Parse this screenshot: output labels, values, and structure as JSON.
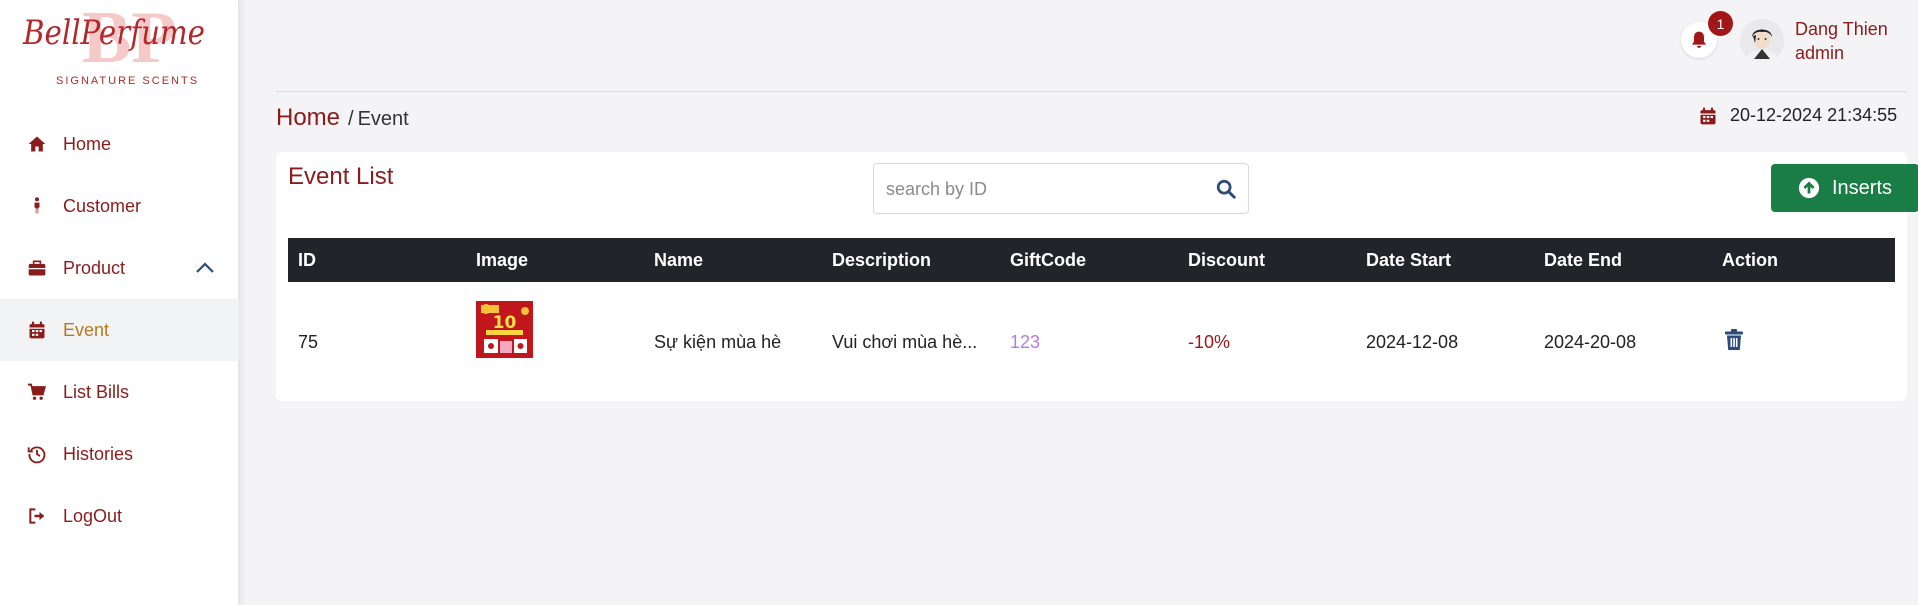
{
  "brand": {
    "name": "BellPerfume",
    "tagline": "SIGNATURE SCENTS",
    "monogram": "BP"
  },
  "sidebar": {
    "items": [
      {
        "label": "Home",
        "icon": "home-icon"
      },
      {
        "label": "Customer",
        "icon": "person-icon"
      },
      {
        "label": "Product",
        "icon": "briefcase-icon"
      },
      {
        "label": "Event",
        "icon": "calendar-icon"
      },
      {
        "label": "List Bills",
        "icon": "cart-icon"
      },
      {
        "label": "Histories",
        "icon": "history-icon"
      },
      {
        "label": "LogOut",
        "icon": "logout-icon"
      }
    ],
    "active": "Event"
  },
  "header": {
    "notification_count": "1",
    "user_name": "Dang Thien",
    "user_role": "admin"
  },
  "breadcrumb": {
    "home": "Home",
    "separator": "/",
    "current": "Event"
  },
  "datetime": "20-12-2024 21:34:55",
  "card": {
    "title": "Event List",
    "search_placeholder": "search by ID",
    "insert_label": "Inserts"
  },
  "table": {
    "columns": [
      "ID",
      "Image",
      "Name",
      "Description",
      "GiftCode",
      "Discount",
      "Date Start",
      "Date End",
      "Action"
    ],
    "rows": [
      {
        "id": "75",
        "name": "Sự kiện mùa hè",
        "description": "Vui chơi mùa hè...",
        "giftcode": "123",
        "discount": "-10%",
        "date_start": "2024-12-08",
        "date_end": "2024-20-08"
      }
    ]
  },
  "colors": {
    "brand": "#8a1c1c",
    "active_nav": "#b27a23",
    "insert_button": "#1a7d46",
    "table_header": "#212529",
    "giftcode": "#b87ae0",
    "icon_blue": "#2c4a7a"
  }
}
